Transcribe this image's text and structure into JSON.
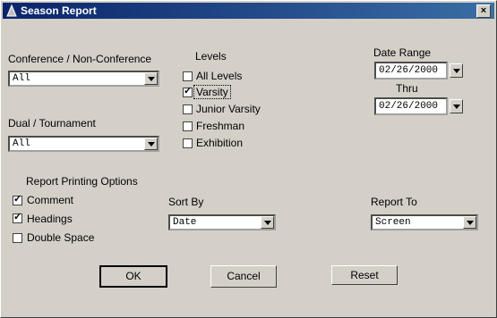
{
  "window": {
    "title": "Season Report",
    "close_symbol": "×"
  },
  "conference": {
    "label": "Conference / Non-Conference",
    "value": "All"
  },
  "dual": {
    "label": "Dual / Tournament",
    "value": "All"
  },
  "levels": {
    "label": "Levels",
    "items": [
      {
        "label": "All Levels",
        "checked": false
      },
      {
        "label": "Varsity",
        "checked": true
      },
      {
        "label": "Junior Varsity",
        "checked": false
      },
      {
        "label": "Freshman",
        "checked": false
      },
      {
        "label": "Exhibition",
        "checked": false
      }
    ]
  },
  "date_range": {
    "label": "Date Range",
    "from": "02/26/2000",
    "thru_label": "Thru",
    "to": "02/26/2000"
  },
  "printing": {
    "label": "Report Printing Options",
    "items": [
      {
        "label": "Comment",
        "checked": true
      },
      {
        "label": "Headings",
        "checked": true
      },
      {
        "label": "Double Space",
        "checked": false
      }
    ]
  },
  "sort_by": {
    "label": "Sort By",
    "value": "Date"
  },
  "report_to": {
    "label": "Report To",
    "value": "Screen"
  },
  "buttons": {
    "ok": "OK",
    "cancel": "Cancel",
    "reset": "Reset"
  }
}
